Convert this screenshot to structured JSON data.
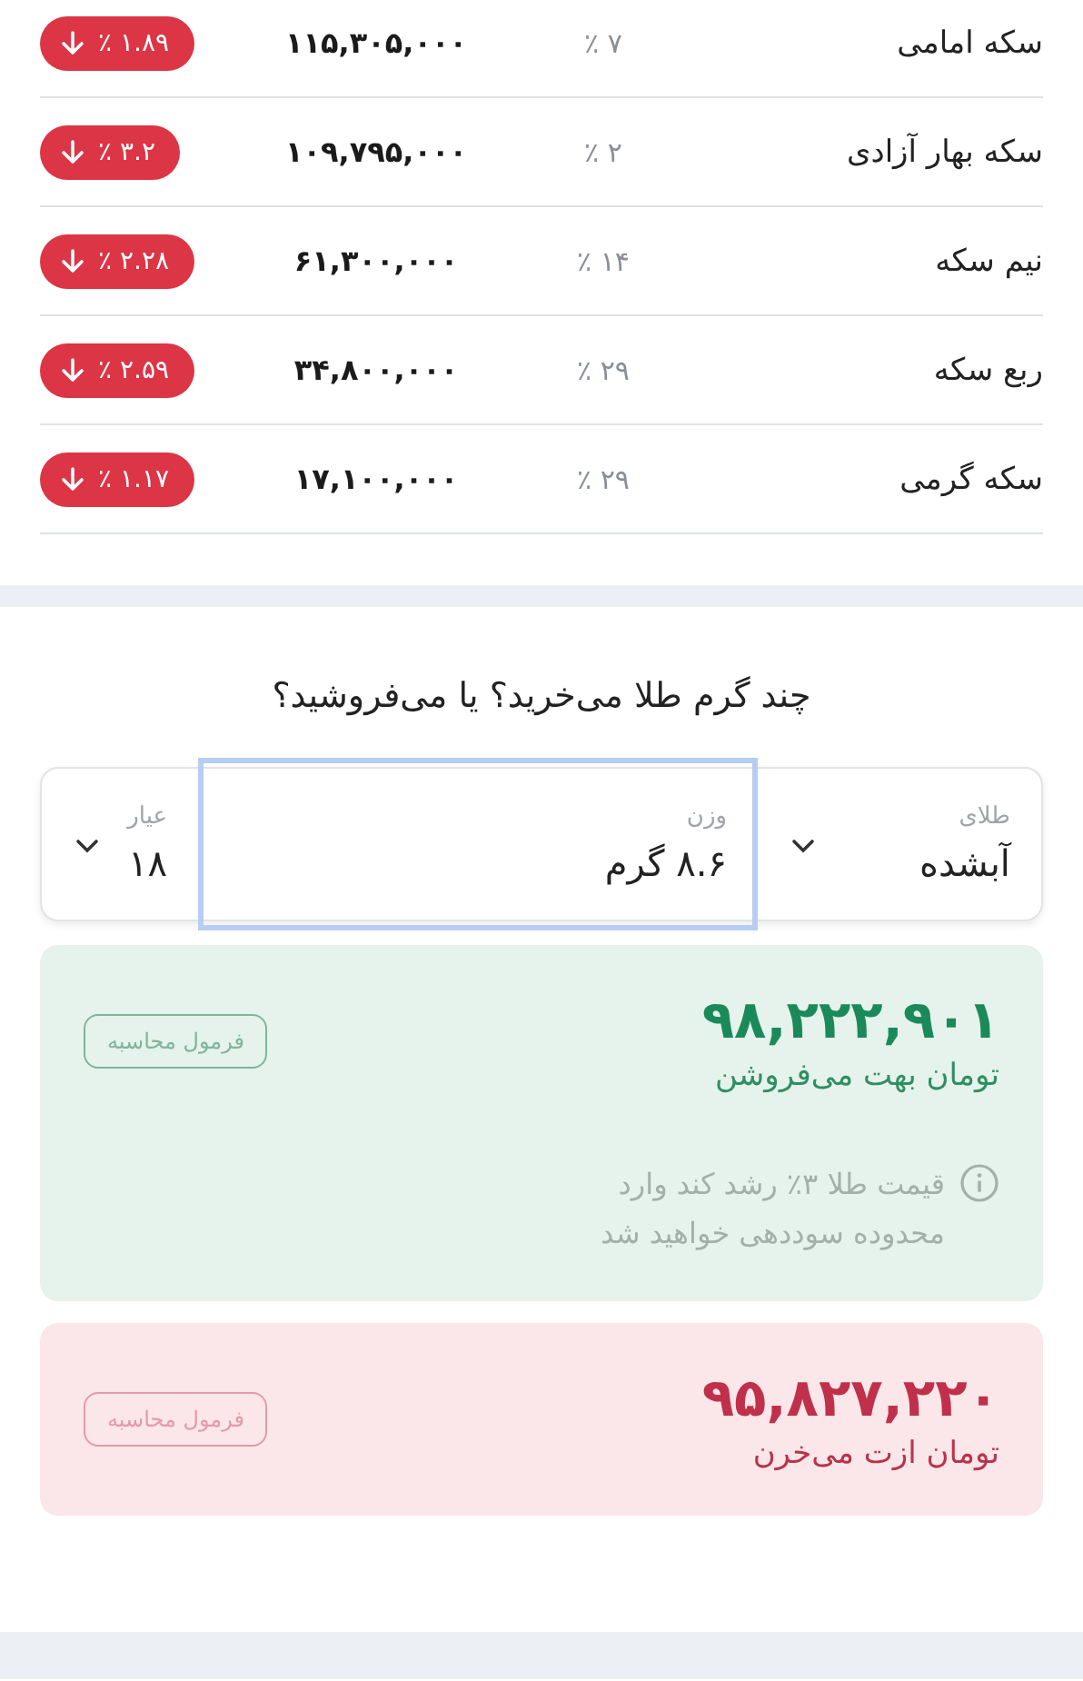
{
  "coins": {
    "rows": [
      {
        "name": "سکه امامی",
        "percent": "٪ ۷",
        "price": "۱۱۵,۳۰۵,۰۰۰",
        "kind": "down",
        "change": "٪ ۱.۸۹"
      },
      {
        "name": "سکه بهار آزادی",
        "percent": "٪ ۲",
        "price": "۱۰۹,۷۹۵,۰۰۰",
        "kind": "down",
        "change": "٪ ۳.۲"
      },
      {
        "name": "نیم سکه",
        "percent": "٪ ۱۴",
        "price": "۶۱,۳۰۰,۰۰۰",
        "kind": "down",
        "change": "٪ ۲.۲۸"
      },
      {
        "name": "ربع سکه",
        "percent": "٪ ۲۹",
        "price": "۳۴,۸۰۰,۰۰۰",
        "kind": "down",
        "change": "٪ ۲.۵۹"
      },
      {
        "name": "سکه گرمی",
        "percent": "٪ ۲۹",
        "price": "۱۷,۱۰۰,۰۰۰",
        "kind": "down",
        "change": "٪ ۱.۱۷"
      }
    ]
  },
  "calculator": {
    "question": "چند گرم طلا می‌خرید؟ یا می‌فروشید؟",
    "fields": [
      {
        "kind": "select",
        "label": "طلای",
        "value": "آبشده",
        "focused": false
      },
      {
        "kind": "input",
        "label": "وزن",
        "value": "۸.۶ گرم",
        "focused": true
      },
      {
        "kind": "select",
        "label": "عیار",
        "value": "۱۸",
        "focused": false
      }
    ]
  },
  "results": [
    {
      "kind": "sell",
      "amount": "۹۸,۲۲۲,۹۰۱",
      "caption": "تومان بهت می‌فروشن",
      "formula_button": "فرمول محاسبه",
      "info": "قیمت طلا ۳٪ رشد کند وارد محدوده سوددهی خواهید شد"
    },
    {
      "kind": "buy",
      "amount": "۹۵,۸۲۷,۲۲۰",
      "caption": "تومان ازت می‌خرن",
      "formula_button": "فرمول محاسبه"
    }
  ]
}
